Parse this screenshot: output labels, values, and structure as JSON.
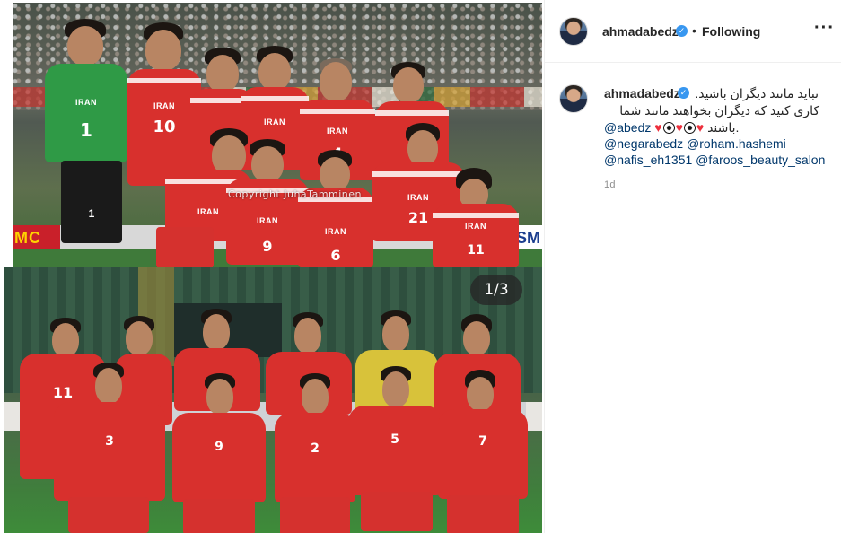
{
  "post": {
    "author": "ahmadabedz",
    "follow_status": "Following",
    "more_icon": "more-horizontal-icon",
    "verified_icon": "verified-badge-icon",
    "carousel_indicator": "1/3",
    "watermark": "Copyright JuhaTamminen",
    "top_photo": {
      "board_left": "MC",
      "board_right": "SM",
      "jersey_text": "IRAN",
      "numbers": [
        "1",
        "10",
        "4",
        "9",
        "6",
        "21",
        "11"
      ]
    },
    "bottom_photo": {
      "numbers": [
        "11",
        "3",
        "9",
        "2",
        "5",
        "7"
      ]
    }
  },
  "caption": {
    "author": "ahmadabedz",
    "line1": "نباید مانند دیگران باشید.",
    "line2": "کاری کنید که دیگران بخواهند مانند شما",
    "line3_text": "باشند.",
    "line3_mention": "@abedz",
    "line4": "@negarabedz @roham.hashemi",
    "line5": "@nafis_eh1351 @faroos_beauty_salon",
    "time": "1d"
  },
  "colors": {
    "accent": "#3897f0",
    "mention": "#00376b",
    "iran_red": "#d8302d",
    "heart": "#ed2f3c"
  }
}
